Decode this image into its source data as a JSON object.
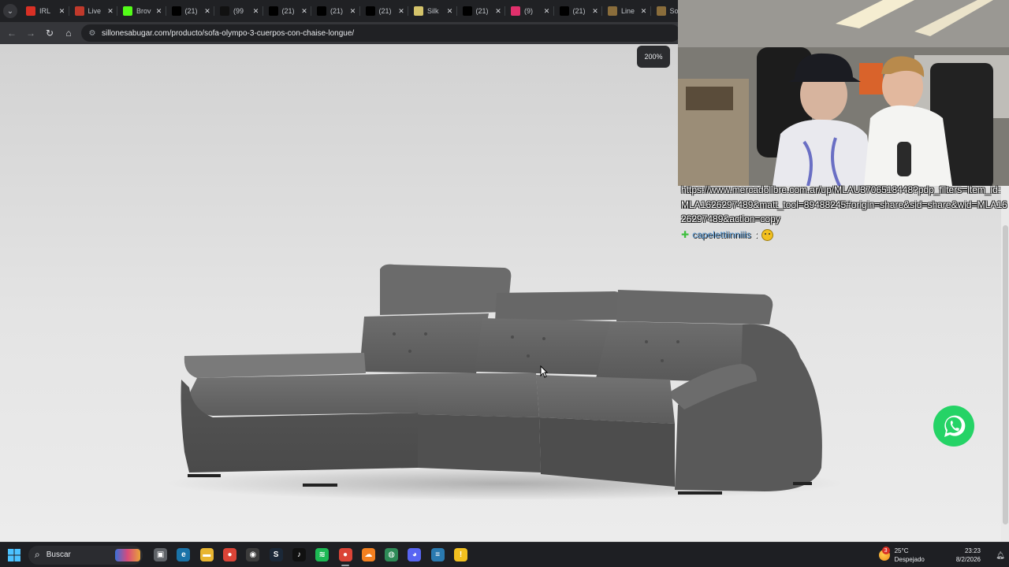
{
  "browser": {
    "tabs": [
      {
        "label": "IRL",
        "icon": "yandex-icon",
        "color": "#d93025"
      },
      {
        "label": "Live",
        "icon": "kick-live-icon",
        "color": "#c0392b"
      },
      {
        "label": "Brov",
        "icon": "kick-icon",
        "color": "#53fc18"
      },
      {
        "label": "(21)",
        "icon": "x-icon",
        "color": "#000000"
      },
      {
        "label": "(99",
        "icon": "tiktok-icon",
        "color": "#111111"
      },
      {
        "label": "(21)",
        "icon": "x-icon",
        "color": "#000000"
      },
      {
        "label": "(21)",
        "icon": "x-icon",
        "color": "#000000"
      },
      {
        "label": "(21)",
        "icon": "x-icon",
        "color": "#000000"
      },
      {
        "label": "Silk",
        "icon": "silk-icon",
        "color": "#d4c36a"
      },
      {
        "label": "(21)",
        "icon": "x-icon",
        "color": "#000000"
      },
      {
        "label": "(9)",
        "icon": "instagram-icon",
        "color": "#e1306c"
      },
      {
        "label": "(21)",
        "icon": "x-icon",
        "color": "#000000"
      },
      {
        "label": "Line",
        "icon": "sofa-site-icon",
        "color": "#8a6d3b"
      },
      {
        "label": "Sof",
        "icon": "sofa-site-icon",
        "color": "#8a6d3b"
      }
    ],
    "url": "sillonesabugar.com/producto/sofa-olympo-3-cuerpos-con-chaise-longue/"
  },
  "page": {
    "zoom": "200%",
    "product_image": "grey-sectional-sofa-with-chaise-longue",
    "whatsapp": "whatsapp-icon"
  },
  "overlay": {
    "chat_url": "https://www.mercadolibre.com.ar/up/MLAU3706518448?pdp_filters=item_id:MLA1626297489&matt_tool=89488245#origin=share&sid=share&wid=MLA1626297489&action=copy",
    "chat_user": "capelettiinniiis",
    "chat_sep": ":",
    "chat_emote": "smile-emote"
  },
  "taskbar": {
    "search_label": "Buscar",
    "apps": [
      {
        "name": "task-view",
        "color": "#5f6368",
        "glyph": "▣"
      },
      {
        "name": "edge",
        "color": "#1a73a8",
        "glyph": "e"
      },
      {
        "name": "file-explorer",
        "color": "#e8b531",
        "glyph": "▬"
      },
      {
        "name": "chrome",
        "color": "#db4437",
        "glyph": "●"
      },
      {
        "name": "obs",
        "color": "#3c3c3c",
        "glyph": "◉"
      },
      {
        "name": "steam",
        "color": "#1b2838",
        "glyph": "S"
      },
      {
        "name": "tiktok",
        "color": "#111111",
        "glyph": "♪"
      },
      {
        "name": "spotify",
        "color": "#1db954",
        "glyph": "≋"
      },
      {
        "name": "chrome-active",
        "color": "#db4437",
        "glyph": "●"
      },
      {
        "name": "cloud-app",
        "color": "#f38020",
        "glyph": "☁"
      },
      {
        "name": "globe-app",
        "color": "#2e8b57",
        "glyph": "◍"
      },
      {
        "name": "discord",
        "color": "#5865f2",
        "glyph": "◕"
      },
      {
        "name": "notepad",
        "color": "#2a7ab0",
        "glyph": "≡"
      },
      {
        "name": "warning",
        "color": "#f2c01f",
        "glyph": "!"
      }
    ],
    "weather_badge": "3",
    "weather_temp": "25°C",
    "weather_desc": "Despejado",
    "time": "23:23",
    "date": "8/2/2026"
  }
}
